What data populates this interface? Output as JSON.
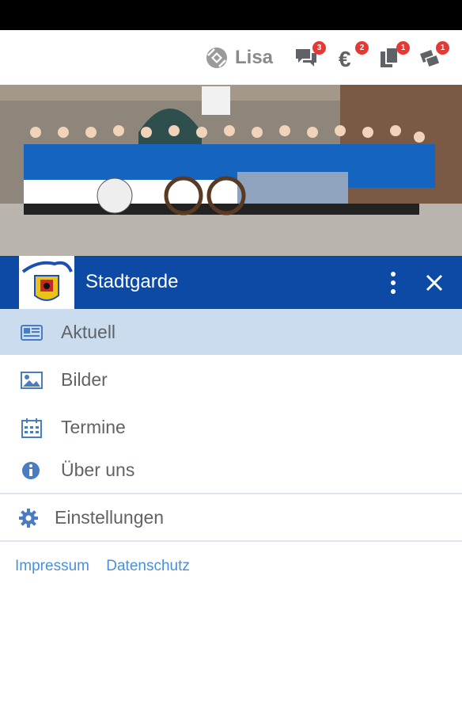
{
  "topbar": {
    "user_name": "Lisa",
    "icons": [
      {
        "name": "chat-icon",
        "badge": "3"
      },
      {
        "name": "euro-icon",
        "badge": "2"
      },
      {
        "name": "documents-icon",
        "badge": "1"
      },
      {
        "name": "tickets-icon",
        "badge": "1"
      }
    ]
  },
  "club": {
    "name": "Stadtgarde",
    "bar_color": "#0c4aa6"
  },
  "nav": {
    "items": [
      {
        "label": "Aktuell",
        "icon": "newspaper-icon",
        "active": true
      },
      {
        "label": "Bilder",
        "icon": "image-icon",
        "active": false
      },
      {
        "label": "Termine",
        "icon": "calendar-icon",
        "active": false
      },
      {
        "label": "Über uns",
        "icon": "info-icon",
        "active": false
      }
    ],
    "settings_label": "Einstellungen"
  },
  "footer": {
    "impressum": "Impressum",
    "datenschutz": "Datenschutz"
  }
}
